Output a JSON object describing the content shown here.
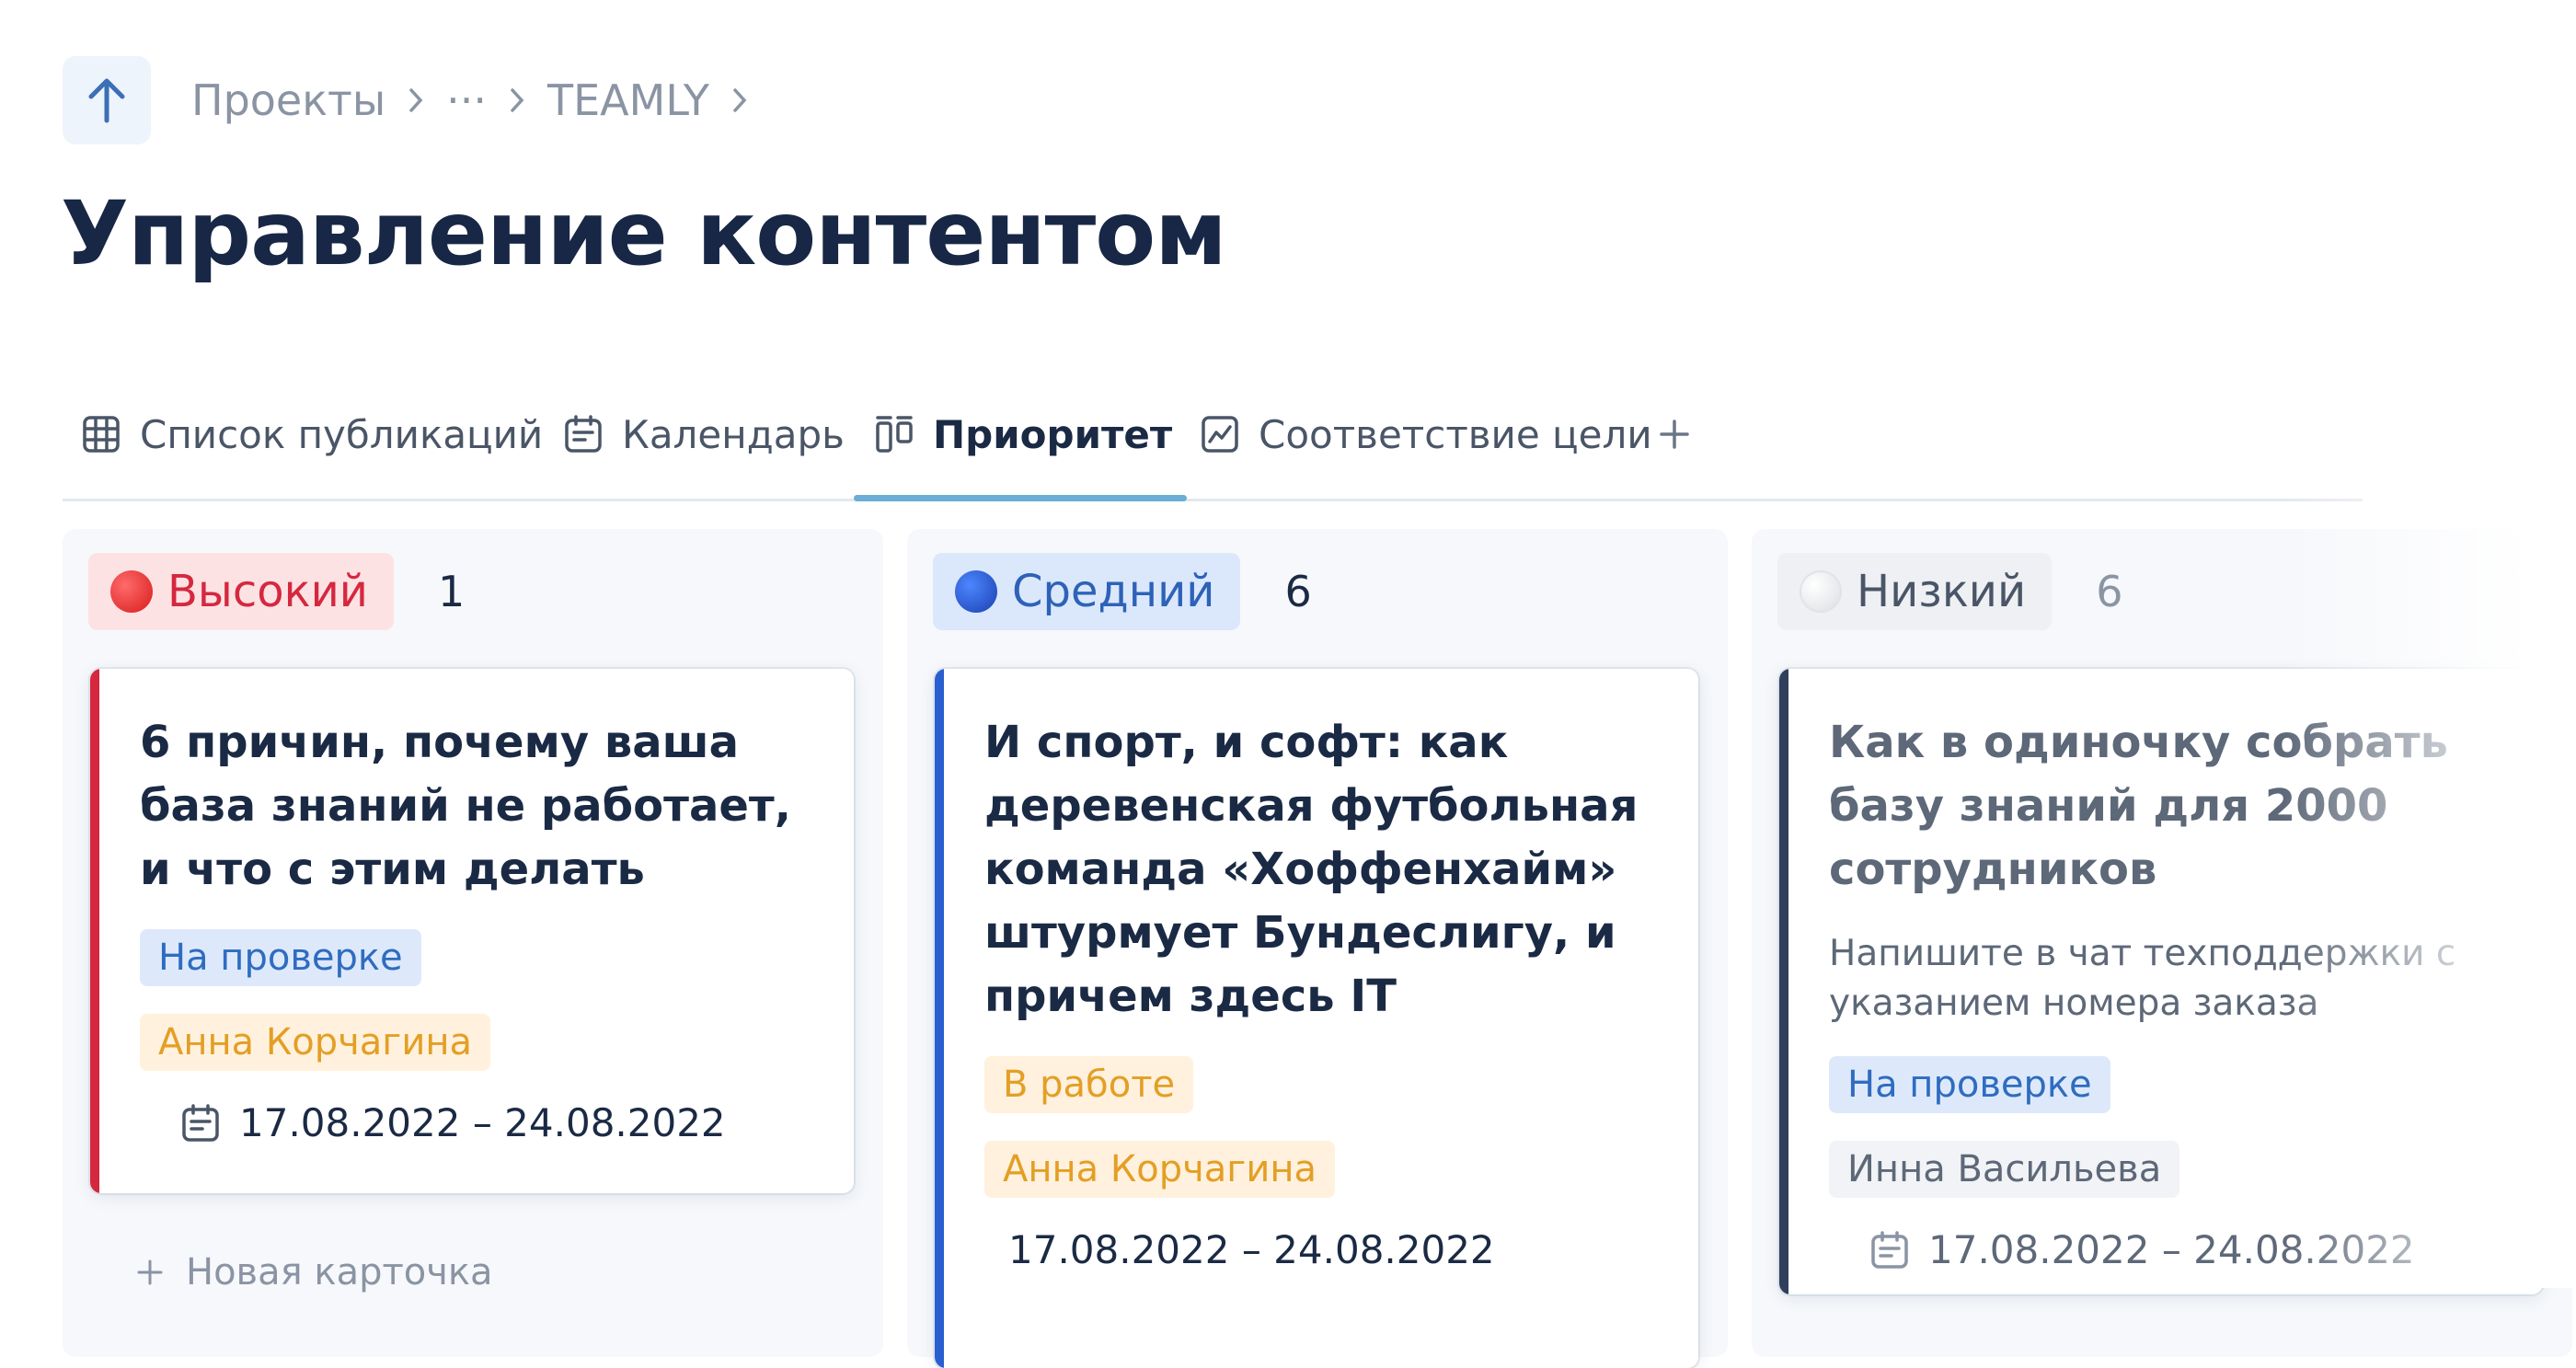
{
  "breadcrumb": {
    "items": [
      "Проекты",
      "···",
      "TEAMLY"
    ]
  },
  "page": {
    "title": "Управление контентом"
  },
  "tabs": [
    {
      "label": "Список публикаций",
      "icon": "table-grid-icon"
    },
    {
      "label": "Календарь",
      "icon": "calendar-icon"
    },
    {
      "label": "Приоритет",
      "icon": "kanban-icon",
      "active": true
    },
    {
      "label": "Соответствие цели",
      "icon": "line-chart-icon"
    }
  ],
  "columns": [
    {
      "label": "Высокий",
      "count": "1",
      "color": "#e53935",
      "cards": [
        {
          "title": "6 причин, почему ваша база знаний не работает, и что с этим делать",
          "status": "На проверке",
          "assignee": "Анна Корчагина",
          "dates": "17.08.2022 – 24.08.2022"
        }
      ],
      "new_card_label": "Новая карточка"
    },
    {
      "label": "Средний",
      "count": "6",
      "color": "#2a5fd0",
      "cards": [
        {
          "title": "И спорт, и софт: как деревенская футбольная команда «Хоффенхайм» штурмует Бундеслигу, и причем здесь IT",
          "status": "В работе",
          "assignee": "Анна Корчагина",
          "dates": "17.08.2022 – 24.08.2022"
        }
      ]
    },
    {
      "label": "Низкий",
      "count": "6",
      "color": "#e6e8ec",
      "cards": [
        {
          "title": "Как в одиночку собрать базу знаний для 2000 сотрудников",
          "description": "Напишите в чат техподдержки с указанием номера заказа",
          "status": "На проверке",
          "assignee": "Инна Васильева",
          "dates": "17.08.2022 – 24.08.2022"
        }
      ]
    }
  ]
}
